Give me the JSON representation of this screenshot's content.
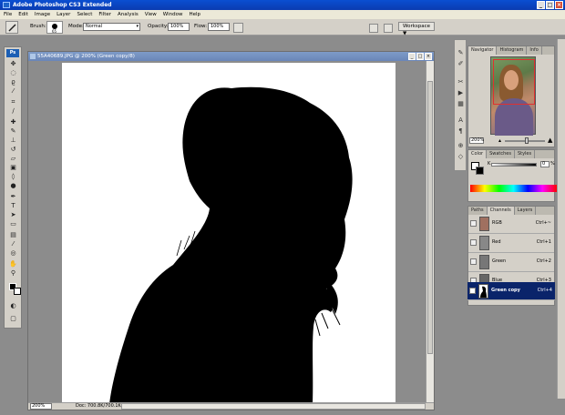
{
  "app": {
    "title": "Adobe Photoshop CS3 Extended"
  },
  "menu": [
    "File",
    "Edit",
    "Image",
    "Layer",
    "Select",
    "Filter",
    "Analysis",
    "View",
    "Window",
    "Help"
  ],
  "options": {
    "brush_label": "Brush:",
    "brush_size": "65",
    "mode_label": "Mode:",
    "mode_value": "Normal",
    "opacity_label": "Opacity:",
    "opacity_value": "100%",
    "flow_label": "Flow:",
    "flow_value": "100%",
    "workspace_label": "Workspace ▼"
  },
  "document": {
    "title": "55A40689.JPG @ 200% (Green copy/8)",
    "zoom": "200%",
    "doc_info": "Doc: 700.8K/700.1K"
  },
  "navigator": {
    "tabs": [
      "Navigator",
      "Histogram",
      "Info"
    ],
    "zoom": "200%"
  },
  "color_panel": {
    "tabs": [
      "Color",
      "Swatches",
      "Styles"
    ],
    "channel_label": "K",
    "value": "0",
    "unit": "%"
  },
  "channels_panel": {
    "tabs": [
      "Paths",
      "Channels",
      "Layers"
    ],
    "rows": [
      {
        "name": "RGB",
        "shortcut": "Ctrl+~"
      },
      {
        "name": "Red",
        "shortcut": "Ctrl+1"
      },
      {
        "name": "Green",
        "shortcut": "Ctrl+2"
      },
      {
        "name": "Blue",
        "shortcut": "Ctrl+3"
      },
      {
        "name": "Green copy",
        "shortcut": "Ctrl+4"
      }
    ],
    "selected": "Green copy"
  },
  "colors": {
    "titlebar": "#0a4fd1",
    "selection": "#0a246a",
    "panel": "#d4d0c8"
  }
}
